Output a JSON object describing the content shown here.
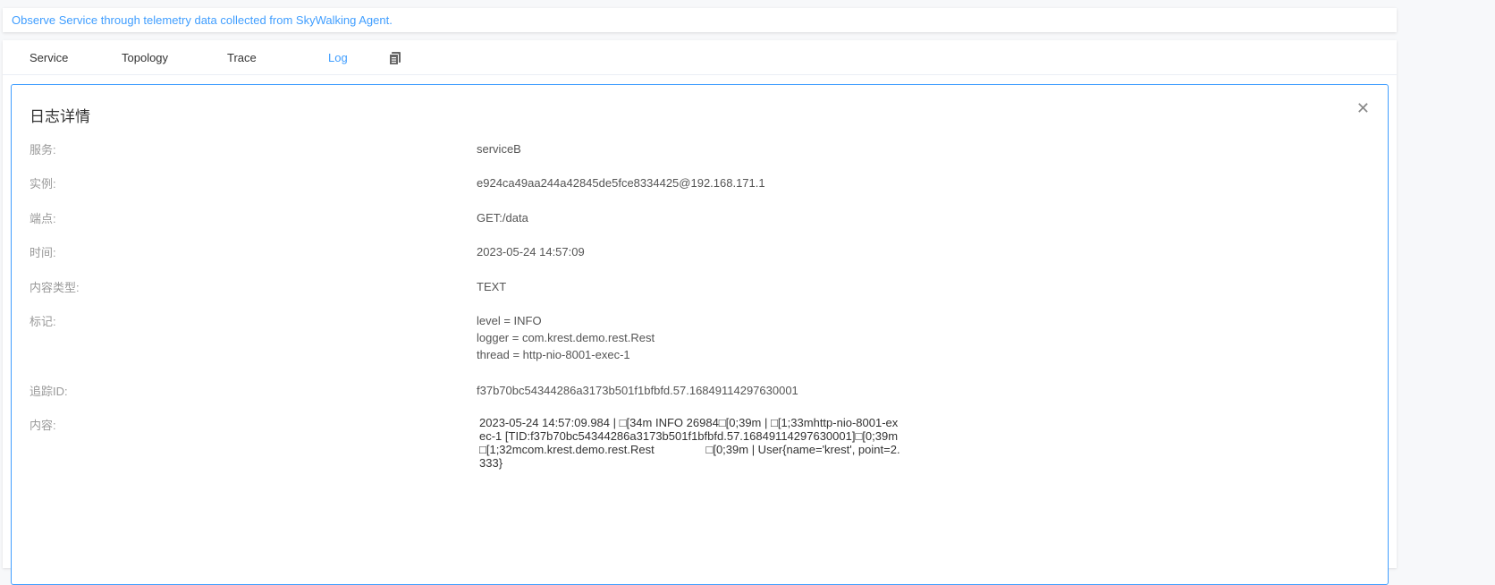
{
  "banner": "Observe Service through telemetry data collected from SkyWalking Agent.",
  "tabs": [
    {
      "label": "Service"
    },
    {
      "label": "Topology"
    },
    {
      "label": "Trace"
    },
    {
      "label": "Log",
      "active": true
    }
  ],
  "tab_icon": "copy-icon",
  "accent": "#409eff",
  "drawer": {
    "title": "日志详情",
    "fields": [
      {
        "label": "服务:",
        "value": "serviceB"
      },
      {
        "label": "实例:",
        "value": "e924ca49aa244a42845de5fce8334425@192.168.171.1"
      },
      {
        "label": "端点:",
        "value": "GET:/data"
      },
      {
        "label": "时间:",
        "value": "2023-05-24 14:57:09"
      },
      {
        "label": "内容类型:",
        "value": "TEXT"
      }
    ],
    "tags_label": "标记:",
    "tags": [
      "level = INFO",
      "logger = com.krest.demo.rest.Rest",
      "thread = http-nio-8001-exec-1"
    ],
    "trace_label": "追踪ID:",
    "trace_id": "f37b70bc54344286a3173b501f1bfbfd.57.16849114297630001",
    "content_label": "内容:",
    "content": "2023-05-24 14:57:09.984 | □[34m INFO 26984□[0;39m | □[1;33mhttp-nio-8001-exec-1 [TID:f37b70bc54344286a3173b501f1bfbfd.57.16849114297630001]□[0;39m □[1;32mcom.krest.demo.rest.Rest                □[0;39m | User{name='krest', point=2.333}"
  }
}
